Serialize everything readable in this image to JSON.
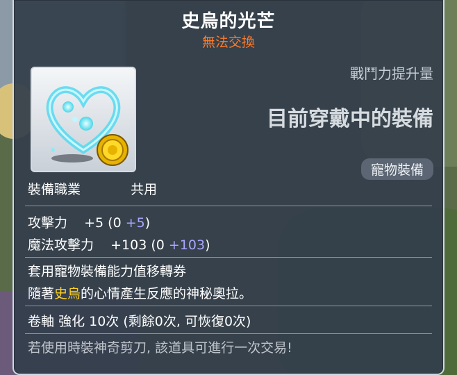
{
  "item": {
    "name": "史烏的光芒",
    "trade_status": "無法交換",
    "stat_change_label": "戰鬥力提升量",
    "equipped_label": "目前穿戴中的裝備",
    "category": "寵物裝備",
    "icon": "glowing-heart-icon"
  },
  "job": {
    "label": "裝備職業",
    "value": "共用"
  },
  "stats": [
    {
      "name": "攻擊力",
      "total": "+5",
      "open": "(0",
      "bonus": "+5",
      "close": ")"
    },
    {
      "name": "魔法攻擊力",
      "total": "+103",
      "open": "(0",
      "bonus": "+103",
      "close": ")"
    }
  ],
  "description": {
    "line1": "套用寵物裝備能力值移轉券",
    "line2_pre": "隨著",
    "line2_highlight": "史烏",
    "line2_post": "的心情產生反應的神秘奧拉。"
  },
  "scroll": {
    "label": "卷軸",
    "enhance": "強化",
    "count": "10次",
    "detail": "(剩餘0次, 可恢復0次)"
  },
  "scissors_note": "若使用時裝神奇剪刀, 該道具可進行一次交易!",
  "colors": {
    "trade_status": "#ff7a2a",
    "bonus": "#a9a6ff",
    "highlight": "#ffd21f"
  }
}
